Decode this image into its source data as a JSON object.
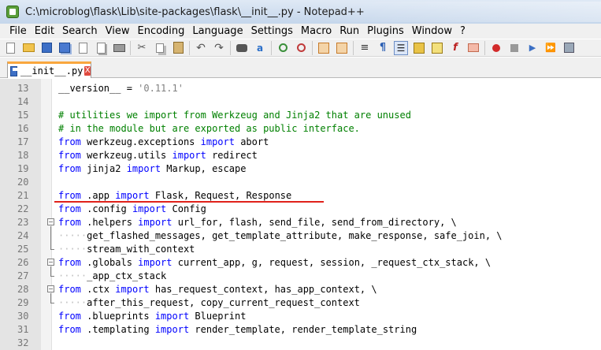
{
  "window": {
    "title": "C:\\microblog\\flask\\Lib\\site-packages\\flask\\__init__.py - Notepad++"
  },
  "menu": {
    "items": [
      "File",
      "Edit",
      "Search",
      "View",
      "Encoding",
      "Language",
      "Settings",
      "Macro",
      "Run",
      "Plugins",
      "Window",
      "?"
    ]
  },
  "toolbar": {
    "icons": [
      "new-file-icon",
      "open-file-icon",
      "save-icon",
      "save-all-icon",
      "close-icon",
      "close-all-icon",
      "print-icon",
      "cut-icon",
      "copy-icon",
      "paste-icon",
      "undo-icon",
      "redo-icon",
      "find-icon",
      "replace-icon",
      "zoom-in-icon",
      "zoom-out-icon",
      "sync-vertical-icon",
      "sync-horizontal-icon",
      "word-wrap-icon",
      "show-all-chars-icon",
      "indent-guide-icon",
      "udl-icon",
      "doc-map-icon",
      "function-list-icon",
      "folder-workspace-icon",
      "record-macro-icon",
      "stop-macro-icon",
      "play-macro-icon",
      "run-macro-multiple-icon",
      "save-macro-icon"
    ],
    "active_icon": "indent-guide-icon"
  },
  "tab": {
    "label": "__init__.py",
    "close": "X"
  },
  "colors": {
    "keyword": "#0000ff",
    "comment": "#008000",
    "string": "#808080",
    "underline": "#e0221b",
    "tab_accent": "#f9a73e"
  },
  "editor": {
    "lines": [
      {
        "n": "13",
        "parts": [
          [
            "",
            "__version__ = "
          ],
          [
            "str",
            "'0.11.1'"
          ]
        ]
      },
      {
        "n": "14",
        "parts": []
      },
      {
        "n": "15",
        "parts": [
          [
            "cmt",
            "# utilities we import from Werkzeug and Jinja2 that are unused"
          ]
        ]
      },
      {
        "n": "16",
        "parts": [
          [
            "cmt",
            "# in the module but are exported as public interface."
          ]
        ]
      },
      {
        "n": "17",
        "parts": [
          [
            "kw",
            "from"
          ],
          [
            "",
            " werkzeug.exceptions "
          ],
          [
            "kw",
            "import"
          ],
          [
            "",
            " abort"
          ]
        ]
      },
      {
        "n": "18",
        "parts": [
          [
            "kw",
            "from"
          ],
          [
            "",
            " werkzeug.utils "
          ],
          [
            "kw",
            "import"
          ],
          [
            "",
            " redirect"
          ]
        ]
      },
      {
        "n": "19",
        "parts": [
          [
            "kw",
            "from"
          ],
          [
            "",
            " jinja2 "
          ],
          [
            "kw",
            "import"
          ],
          [
            "",
            " Markup, escape"
          ]
        ]
      },
      {
        "n": "20",
        "parts": []
      },
      {
        "n": "21",
        "parts": [
          [
            "kw",
            "from"
          ],
          [
            "",
            " .app "
          ],
          [
            "kw",
            "import"
          ],
          [
            "",
            " Flask, Request, Response"
          ]
        ]
      },
      {
        "n": "22",
        "parts": [
          [
            "kw",
            "from"
          ],
          [
            "",
            " .config "
          ],
          [
            "kw",
            "import"
          ],
          [
            "",
            " Config"
          ]
        ]
      },
      {
        "n": "23",
        "parts": [
          [
            "kw",
            "from"
          ],
          [
            "",
            " .helpers "
          ],
          [
            "kw",
            "import"
          ],
          [
            "",
            " url_for, flash, send_file, send_from_directory, \\"
          ]
        ]
      },
      {
        "n": "24",
        "parts": [
          [
            "ind",
            "·····"
          ],
          [
            "",
            "get_flashed_messages, get_template_attribute, make_response, safe_join, \\"
          ]
        ]
      },
      {
        "n": "25",
        "parts": [
          [
            "ind",
            "·····"
          ],
          [
            "",
            "stream_with_context"
          ]
        ]
      },
      {
        "n": "26",
        "parts": [
          [
            "kw",
            "from"
          ],
          [
            "",
            " .globals "
          ],
          [
            "kw",
            "import"
          ],
          [
            "",
            " current_app, g, request, session, _request_ctx_stack, \\"
          ]
        ]
      },
      {
        "n": "27",
        "parts": [
          [
            "ind",
            "·····"
          ],
          [
            "",
            "_app_ctx_stack"
          ]
        ]
      },
      {
        "n": "28",
        "parts": [
          [
            "kw",
            "from"
          ],
          [
            "",
            " .ctx "
          ],
          [
            "kw",
            "import"
          ],
          [
            "",
            " has_request_context, has_app_context, \\"
          ]
        ]
      },
      {
        "n": "29",
        "parts": [
          [
            "ind",
            "·····"
          ],
          [
            "",
            "after_this_request, copy_current_request_context"
          ]
        ]
      },
      {
        "n": "30",
        "parts": [
          [
            "kw",
            "from"
          ],
          [
            "",
            " .blueprints "
          ],
          [
            "kw",
            "import"
          ],
          [
            "",
            " Blueprint"
          ]
        ]
      },
      {
        "n": "31",
        "parts": [
          [
            "kw",
            "from"
          ],
          [
            "",
            " .templating "
          ],
          [
            "kw",
            "import"
          ],
          [
            "",
            " render_template, render_template_string"
          ]
        ]
      },
      {
        "n": "32",
        "parts": []
      }
    ]
  }
}
